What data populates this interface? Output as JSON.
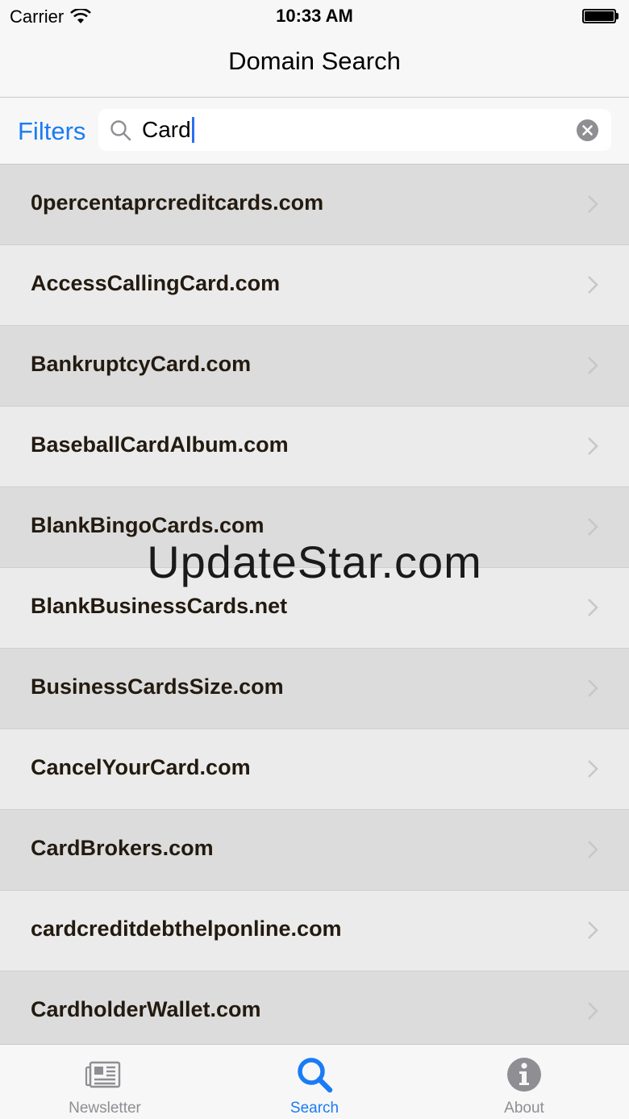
{
  "status_bar": {
    "carrier": "Carrier",
    "time": "10:33 AM"
  },
  "nav": {
    "title": "Domain Search"
  },
  "search": {
    "filters_label": "Filters",
    "query": "Card"
  },
  "results": [
    "0percentaprcreditcards.com",
    "AccessCallingCard.com",
    "BankruptcyCard.com",
    "BaseballCardAlbum.com",
    "BlankBingoCards.com",
    "BlankBusinessCards.net",
    "BusinessCardsSize.com",
    "CancelYourCard.com",
    "CardBrokers.com",
    "cardcreditdebthelponline.com",
    "CardholderWallet.com"
  ],
  "watermark": "UpdateStar.com",
  "tabs": [
    {
      "label": "Newsletter",
      "icon": "newspaper-icon",
      "active": false
    },
    {
      "label": "Search",
      "icon": "search-icon",
      "active": true
    },
    {
      "label": "About",
      "icon": "info-icon",
      "active": false
    }
  ],
  "colors": {
    "accent": "#1a7cf5",
    "row_odd": "#dcdcdc",
    "row_even": "#ebebeb",
    "inactive_tab": "#8e8e93"
  }
}
